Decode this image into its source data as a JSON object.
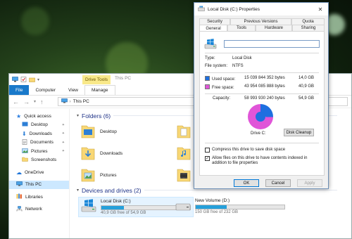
{
  "explorer": {
    "contextual_tab": "Drive Tools",
    "window_name": "This PC",
    "ribbon_tabs": [
      "File",
      "Computer",
      "View",
      "Manage"
    ],
    "address": "This PC",
    "nav": {
      "quick_access": "Quick access",
      "desktop": "Desktop",
      "downloads": "Downloads",
      "documents": "Documents",
      "pictures": "Pictures",
      "screenshots": "Screenshots",
      "onedrive": "OneDrive",
      "this_pc": "This PC",
      "libraries": "Libraries",
      "network": "Network"
    },
    "folders_header": "Folders (6)",
    "folders": [
      "Desktop",
      "Downloads",
      "Pictures"
    ],
    "devices_header": "Devices and drives (2)",
    "drives": [
      {
        "name": "Local Disk (C:)",
        "free": "40,9 GB free of 54,9 GB",
        "used_fraction": 0.255
      },
      {
        "name": "New Volume (D:)",
        "free": "150 GB free of 232 GB",
        "used_fraction": 0.353
      }
    ]
  },
  "props": {
    "title": "Local Disk (C:) Properties",
    "tabs_row1": [
      "Security",
      "Previous Versions",
      "Quota"
    ],
    "tabs_row2": [
      "General",
      "Tools",
      "Hardware",
      "Sharing"
    ],
    "name_value": "",
    "type_label": "Type:",
    "type_value": "Local Disk",
    "fs_label": "File system:",
    "fs_value": "NTFS",
    "used_label": "Used space:",
    "used_bytes": "15 039 844 352 bytes",
    "used_gb": "14,0 GB",
    "free_label": "Free space:",
    "free_bytes": "43 954 085 888 bytes",
    "free_gb": "40,9 GB",
    "capacity_label": "Capacity:",
    "capacity_bytes": "58 993 930 240 bytes",
    "capacity_gb": "54,9 GB",
    "drive_caption": "Drive C:",
    "cleanup": "Disk Cleanup",
    "compress_label": "Compress this drive to save disk space",
    "index_label": "Allow files on this drive to have contents indexed in addition to file properties",
    "ok": "OK",
    "cancel": "Cancel",
    "apply": "Apply",
    "used_color": "#1e6fe0",
    "free_color": "#e055d8",
    "used_fraction": 0.255
  }
}
